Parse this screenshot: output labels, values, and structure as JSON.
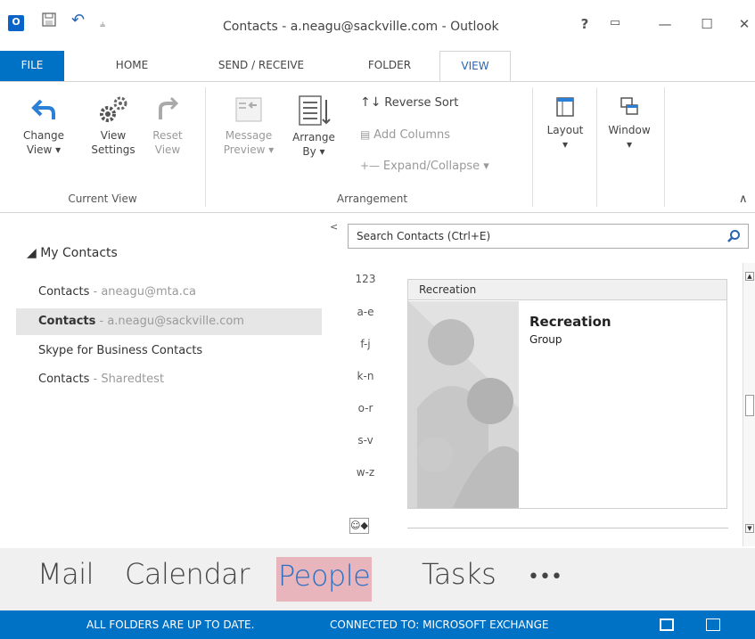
{
  "window": {
    "title": "Contacts - a.neagu@sackville.com - Outlook",
    "help": "?",
    "minimize": "—",
    "maximize": "☐",
    "close": "✕",
    "ribbon_display": "▭"
  },
  "qat": {
    "undo": "↶",
    "customize": "⫨"
  },
  "tabs": [
    {
      "label": "FILE"
    },
    {
      "label": "HOME"
    },
    {
      "label": "SEND / RECEIVE"
    },
    {
      "label": "FOLDER"
    },
    {
      "label": "VIEW",
      "active": true
    }
  ],
  "ribbon": {
    "current_view": {
      "label": "Current View",
      "change_view": {
        "line1": "Change",
        "line2": "View ▾"
      },
      "view_settings": {
        "line1": "View",
        "line2": "Settings"
      },
      "reset_view": {
        "line1": "Reset",
        "line2": "View"
      }
    },
    "arrangement": {
      "label": "Arrangement",
      "message_preview": {
        "line1": "Message",
        "line2": "Preview ▾"
      },
      "arrange_by": {
        "line1": "Arrange",
        "line2": "By ▾"
      },
      "reverse_sort": "Reverse Sort",
      "add_columns": "Add Columns",
      "expand_collapse": "Expand/Collapse ▾"
    },
    "layout": {
      "line1": "Layout",
      "line2": "▾"
    },
    "window": {
      "line1": "Window",
      "line2": "▾"
    },
    "collapse": "∧"
  },
  "nav": {
    "collapse_arrow": "<",
    "section": "◢ My Contacts",
    "items": [
      {
        "label": "Contacts",
        "sub": " - aneagu@mta.ca"
      },
      {
        "label": "Contacts",
        "sub": " - a.neagu@sackville.com",
        "selected": true
      },
      {
        "label": "Skype for Business Contacts",
        "sub": ""
      },
      {
        "label": "Contacts",
        "sub": " - Sharedtest"
      }
    ]
  },
  "search": {
    "placeholder": "Search Contacts (Ctrl+E)"
  },
  "alpha": [
    "123",
    "a-e",
    "f-j",
    "k-n",
    "o-r",
    "s-v",
    "w-z"
  ],
  "card": {
    "header": "Recreation",
    "name": "Recreation",
    "type": "Group"
  },
  "bottomnav": {
    "mail": "Mail",
    "calendar": "Calendar",
    "people": "People",
    "tasks": "Tasks",
    "more": "•••"
  },
  "status": {
    "folders": "ALL FOLDERS ARE UP TO DATE.",
    "connection": "CONNECTED TO: MICROSOFT EXCHANGE"
  },
  "colors": {
    "accent": "#0072c6",
    "people_highlight": "#e8b5bd",
    "selected_row": "#e6e6e6"
  }
}
